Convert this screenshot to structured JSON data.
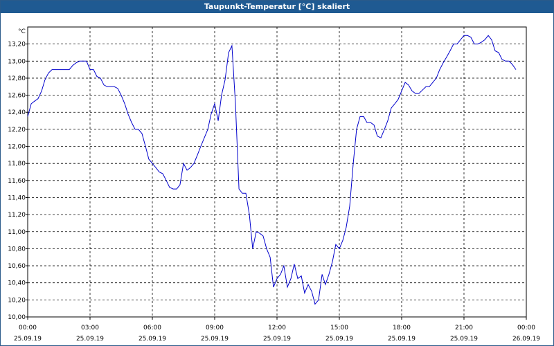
{
  "window": {
    "title": "Taupunkt-Temperatur [°C] skaliert"
  },
  "chart_data": {
    "type": "line",
    "title": "Taupunkt-Temperatur [°C] skaliert",
    "y_unit": "°C",
    "ylim": [
      10.0,
      13.4
    ],
    "xlim_hours": [
      0,
      24
    ],
    "grid": true,
    "line_color": "#0000cc",
    "y_ticks": [
      "10,00",
      "10,20",
      "10,40",
      "10,60",
      "10,80",
      "11,00",
      "11,20",
      "11,40",
      "11,60",
      "11,80",
      "12,00",
      "12,20",
      "12,40",
      "12,60",
      "12,80",
      "13,00",
      "13,20"
    ],
    "x_ticks": [
      {
        "time": "00:00",
        "date": "25.09.19"
      },
      {
        "time": "03:00",
        "date": "25.09.19"
      },
      {
        "time": "06:00",
        "date": "25.09.19"
      },
      {
        "time": "09:00",
        "date": "25.09.19"
      },
      {
        "time": "12:00",
        "date": "25.09.19"
      },
      {
        "time": "15:00",
        "date": "25.09.19"
      },
      {
        "time": "18:00",
        "date": "25.09.19"
      },
      {
        "time": "21:00",
        "date": "25.09.19"
      },
      {
        "time": "00:00",
        "date": "26.09.19"
      }
    ],
    "x_hours": [
      0,
      0.17,
      0.33,
      0.5,
      0.67,
      0.83,
      1.0,
      1.17,
      1.33,
      1.5,
      1.67,
      1.83,
      2.0,
      2.17,
      2.33,
      2.5,
      2.67,
      2.83,
      3.0,
      3.17,
      3.33,
      3.5,
      3.67,
      3.83,
      4.0,
      4.17,
      4.33,
      4.5,
      4.67,
      4.83,
      5.0,
      5.17,
      5.33,
      5.5,
      5.67,
      5.83,
      6.0,
      6.17,
      6.33,
      6.5,
      6.67,
      6.83,
      7.0,
      7.17,
      7.33,
      7.5,
      7.67,
      7.83,
      8.0,
      8.17,
      8.33,
      8.5,
      8.67,
      8.83,
      9.0,
      9.17,
      9.33,
      9.5,
      9.67,
      9.83,
      10.0,
      10.17,
      10.33,
      10.5,
      10.67,
      10.83,
      11.0,
      11.17,
      11.33,
      11.5,
      11.67,
      11.83,
      12.0,
      12.17,
      12.33,
      12.5,
      12.67,
      12.83,
      13.0,
      13.17,
      13.33,
      13.5,
      13.67,
      13.83,
      14.0,
      14.17,
      14.33,
      14.5,
      14.67,
      14.83,
      15.0,
      15.17,
      15.33,
      15.5,
      15.67,
      15.83,
      16.0,
      16.17,
      16.33,
      16.5,
      16.67,
      16.83,
      17.0,
      17.17,
      17.33,
      17.5,
      17.67,
      17.83,
      18.0,
      18.17,
      18.33,
      18.5,
      18.67,
      18.83,
      19.0,
      19.17,
      19.33,
      19.5,
      19.67,
      19.83,
      20.0,
      20.17,
      20.33,
      20.5,
      20.67,
      20.83,
      21.0,
      21.17,
      21.33,
      21.5,
      21.67,
      21.83,
      22.0,
      22.17,
      22.33,
      22.5,
      22.67,
      22.83,
      23.0,
      23.17,
      23.33,
      23.5,
      23.67,
      23.83,
      24.0
    ],
    "values": [
      12.35,
      12.5,
      12.53,
      12.56,
      12.65,
      12.78,
      12.86,
      12.9,
      12.9,
      12.9,
      12.9,
      12.9,
      12.9,
      12.95,
      12.98,
      13.0,
      13.0,
      13.0,
      12.9,
      12.9,
      12.82,
      12.8,
      12.72,
      12.7,
      12.7,
      12.7,
      12.68,
      12.6,
      12.5,
      12.38,
      12.28,
      12.2,
      12.2,
      12.15,
      12.0,
      11.85,
      11.8,
      11.75,
      11.7,
      11.68,
      11.6,
      11.52,
      11.5,
      11.5,
      11.55,
      11.8,
      11.72,
      11.75,
      11.8,
      11.9,
      12.0,
      12.1,
      12.2,
      12.38,
      12.5,
      12.3,
      12.6,
      12.78,
      13.1,
      13.18,
      12.5,
      11.5,
      11.45,
      11.45,
      11.2,
      10.8,
      11.0,
      10.98,
      10.95,
      10.8,
      10.7,
      10.35,
      10.45,
      10.5,
      10.6,
      10.35,
      10.45,
      10.62,
      10.45,
      10.48,
      10.28,
      10.38,
      10.3,
      10.15,
      10.2,
      10.5,
      10.38,
      10.5,
      10.65,
      10.85,
      10.8,
      10.9,
      11.05,
      11.3,
      11.8,
      12.2,
      12.35,
      12.35,
      12.28,
      12.28,
      12.25,
      12.12,
      12.1,
      12.2,
      12.3,
      12.45,
      12.5,
      12.55,
      12.65,
      12.75,
      12.72,
      12.65,
      12.62,
      12.62,
      12.66,
      12.7,
      12.7,
      12.75,
      12.8,
      12.9,
      12.98,
      13.05,
      13.12,
      13.2,
      13.2,
      13.25,
      13.3,
      13.3,
      13.28,
      13.2,
      13.2,
      13.22,
      13.25,
      13.3,
      13.25,
      13.12,
      13.1,
      13.02,
      13.0,
      13.0,
      12.96,
      12.9
    ]
  }
}
